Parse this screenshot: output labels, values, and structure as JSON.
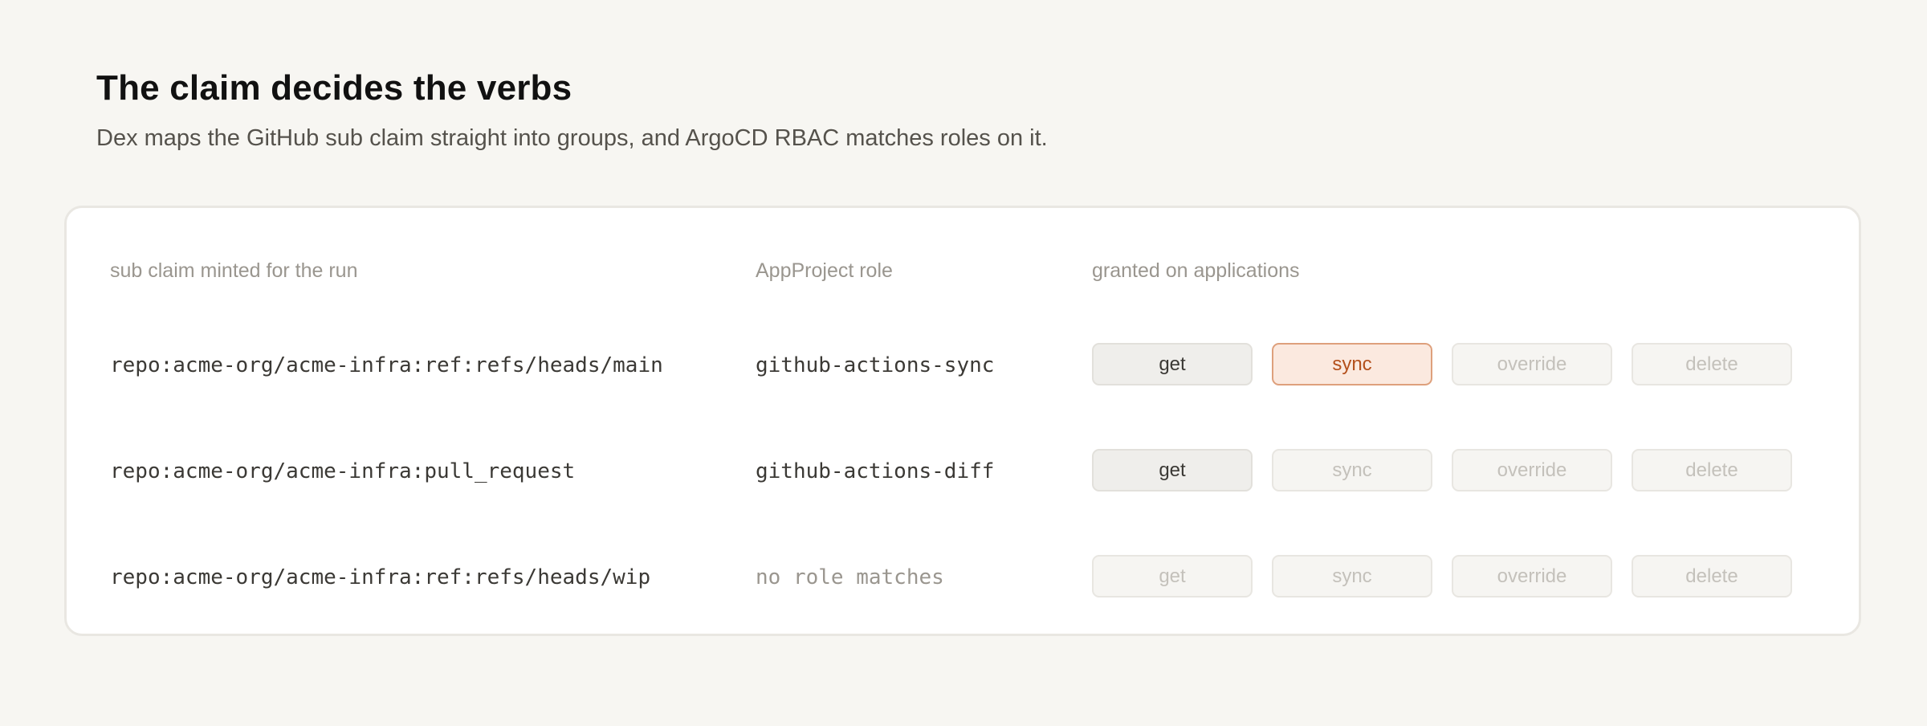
{
  "header": {
    "title": "The claim decides the verbs",
    "subtitle": "Dex maps the GitHub sub claim straight into groups, and ArgoCD RBAC matches roles on it."
  },
  "table": {
    "columns": [
      "sub claim minted for the run",
      "AppProject role",
      "granted on applications"
    ],
    "rows": [
      {
        "claim": "repo:acme-org/acme-infra:ref:refs/heads/main",
        "role": "github-actions-sync",
        "verbs": [
          {
            "label": "get",
            "state": "granted"
          },
          {
            "label": "sync",
            "state": "highlighted"
          },
          {
            "label": "override",
            "state": "denied"
          },
          {
            "label": "delete",
            "state": "denied"
          }
        ]
      },
      {
        "claim": "repo:acme-org/acme-infra:pull_request",
        "role": "github-actions-diff",
        "verbs": [
          {
            "label": "get",
            "state": "granted"
          },
          {
            "label": "sync",
            "state": "denied"
          },
          {
            "label": "override",
            "state": "denied"
          },
          {
            "label": "delete",
            "state": "denied"
          }
        ]
      },
      {
        "claim": "repo:acme-org/acme-infra:ref:refs/heads/wip",
        "role": "no role matches",
        "verbs": [
          {
            "label": "get",
            "state": "denied"
          },
          {
            "label": "sync",
            "state": "denied"
          },
          {
            "label": "override",
            "state": "denied"
          },
          {
            "label": "delete",
            "state": "denied"
          }
        ]
      }
    ]
  },
  "colors": {
    "background": "#f7f6f2",
    "card": "#ffffff",
    "accent": "#b4501c",
    "accent_fill": "#fbe9df",
    "accent_border": "#dea07c"
  }
}
